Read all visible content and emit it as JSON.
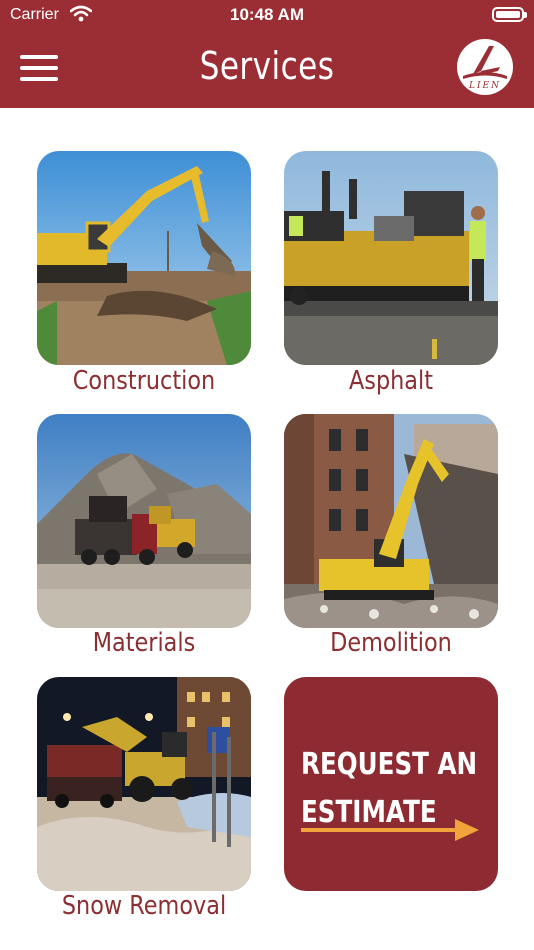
{
  "status_bar": {
    "carrier": "Carrier",
    "time": "10:48 AM"
  },
  "header": {
    "title": "Services",
    "logo_text": "LIEN"
  },
  "services": [
    {
      "label": "Construction"
    },
    {
      "label": "Asphalt"
    },
    {
      "label": "Materials"
    },
    {
      "label": "Demolition"
    },
    {
      "label": "Snow Removal"
    }
  ],
  "estimate": {
    "line1": "REQUEST AN",
    "line2": "ESTIMATE"
  },
  "colors": {
    "brand": "#9b2e35",
    "label": "#8c2f33",
    "accent": "#f2a33a"
  },
  "icons": [
    "wifi-icon",
    "battery-icon",
    "menu-icon",
    "arrow-right-icon"
  ]
}
